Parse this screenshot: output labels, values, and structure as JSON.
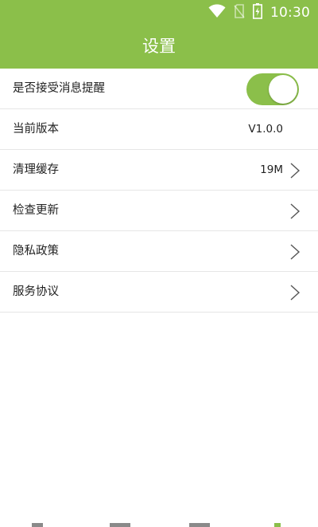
{
  "status_bar": {
    "time": "10:30",
    "icons": [
      "wifi-icon",
      "no-sim-icon",
      "battery-charging-icon"
    ]
  },
  "header": {
    "title": "设置",
    "background_color": "#8bbf4a"
  },
  "settings": {
    "notification": {
      "label": "是否接受消息提醒",
      "enabled": true,
      "toggle_color": "#8bbf4a"
    },
    "version": {
      "label": "当前版本",
      "value": "V1.0.0"
    },
    "cache": {
      "label": "清理缓存",
      "value": "19M"
    },
    "update": {
      "label": "检查更新"
    },
    "privacy": {
      "label": "隐私政策"
    },
    "service": {
      "label": "服务协议"
    }
  }
}
